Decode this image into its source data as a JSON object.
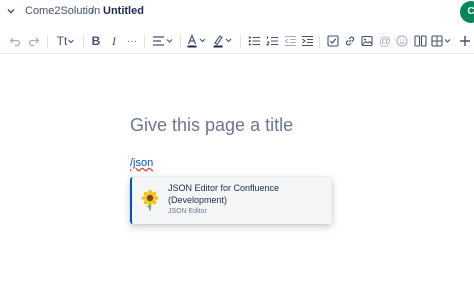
{
  "breadcrumb": {
    "space": "Come2Solution",
    "separator": "/",
    "page": "Untitled"
  },
  "user": {
    "initial": "C"
  },
  "toolbar": {
    "text_style": "Tt",
    "more": "···",
    "icons": [
      "undo-icon",
      "redo-icon",
      "text-style-icon",
      "bold-icon",
      "italic-icon",
      "more-formatting-icon",
      "align-icon",
      "text-color-icon",
      "highlight-icon",
      "bullet-list-icon",
      "numbered-list-icon",
      "outdent-icon",
      "indent-icon",
      "task-icon",
      "link-icon",
      "image-icon",
      "mention-icon",
      "emoji-icon",
      "layout-icon",
      "table-icon",
      "insert-icon"
    ]
  },
  "editor": {
    "title_placeholder": "Give this page a title",
    "typed_text": "/json"
  },
  "suggestions": [
    {
      "title": "JSON Editor for Confluence (Development)",
      "description": "JSON Editor",
      "icon": "sunflower-icon"
    }
  ],
  "colors": {
    "accent": "#0052cc",
    "avatar": "#00875a",
    "text": "#172b4d",
    "muted": "#6b778c"
  }
}
